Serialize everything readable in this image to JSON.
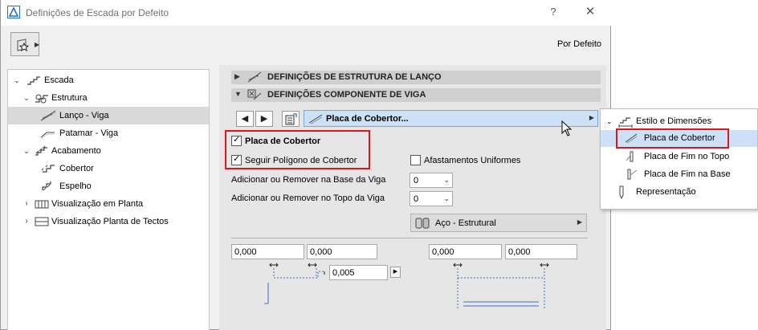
{
  "window": {
    "title": "Definições de Escada por Defeito",
    "help": "?",
    "close": "✕"
  },
  "header": {
    "preset_label": "Por Defeito"
  },
  "tree": {
    "items": [
      {
        "label": "Escada",
        "icon": "stair-icon"
      },
      {
        "label": "Estrutura",
        "icon": "structure-icon"
      },
      {
        "label": "Lanço - Viga",
        "icon": "flight-beam-icon",
        "selected": true
      },
      {
        "label": "Patamar - Viga",
        "icon": "landing-beam-icon"
      },
      {
        "label": "Acabamento",
        "icon": "finish-icon"
      },
      {
        "label": "Cobertor",
        "icon": "tread-icon"
      },
      {
        "label": "Espelho",
        "icon": "riser-icon"
      },
      {
        "label": "Visualização em Planta",
        "icon": "floor-plan-icon"
      },
      {
        "label": "Visualização Planta de Tectos",
        "icon": "ceiling-plan-icon"
      }
    ]
  },
  "sections": {
    "flight_structure": "DEFINIÇÕES DE ESTRUTURA DE LANÇO",
    "beam_component": "DEFINIÇÕES COMPONENTE DE VIGA"
  },
  "component_select": {
    "value": "Placa de Cobertor..."
  },
  "options": {
    "tread_plate": "Placa de Cobertor",
    "follow_tread_polygon": "Seguir Polígono de Cobertor",
    "uniform_offsets": "Afastamentos Uniformes",
    "add_remove_base": "Adicionar ou Remover na Base da Viga",
    "add_remove_top": "Adicionar ou Remover no Topo da Viga",
    "base_value": "0",
    "top_value": "0"
  },
  "material": {
    "label": "Aço - Estrutural"
  },
  "dimensions": {
    "left_a": "0,000",
    "left_b": "0,000",
    "step": "0,005",
    "right_a": "0,000",
    "right_b": "0,000"
  },
  "popup_menu": {
    "items": [
      {
        "label": "Estilo e Dimensões",
        "icon": "style-dimensions-icon"
      },
      {
        "label": "Placa de Cobertor",
        "icon": "tread-plate-icon",
        "selected": true
      },
      {
        "label": "Placa de Fim no Topo",
        "icon": "top-end-plate-icon"
      },
      {
        "label": "Placa de Fim na Base",
        "icon": "base-end-plate-icon"
      },
      {
        "label": "Representação",
        "icon": "representation-icon"
      }
    ]
  },
  "colors": {
    "highlight_red": "#e0141b",
    "selection_blue": "#cde0f5",
    "selection_blue_border": "#7aa7d6"
  }
}
